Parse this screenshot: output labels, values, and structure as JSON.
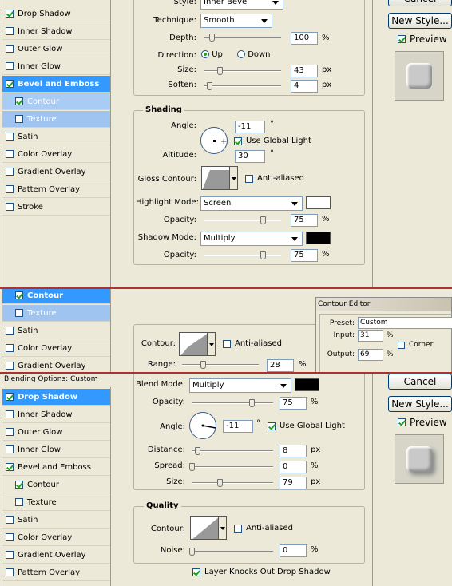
{
  "panel1": {
    "styles": [
      {
        "label": "Drop Shadow",
        "checked": true
      },
      {
        "label": "Inner Shadow",
        "checked": false
      },
      {
        "label": "Outer Glow",
        "checked": false
      },
      {
        "label": "Inner Glow",
        "checked": false
      },
      {
        "label": "Bevel and Emboss",
        "checked": true
      },
      {
        "label": "Contour",
        "checked": true
      },
      {
        "label": "Texture",
        "checked": false
      },
      {
        "label": "Satin",
        "checked": false
      },
      {
        "label": "Color Overlay",
        "checked": false
      },
      {
        "label": "Gradient Overlay",
        "checked": false
      },
      {
        "label": "Pattern Overlay",
        "checked": false
      },
      {
        "label": "Stroke",
        "checked": false
      }
    ],
    "style_label": "Style:",
    "style_value": "Inner Bevel",
    "technique_label": "Technique:",
    "technique_value": "Smooth",
    "depth_label": "Depth:",
    "depth_value": "100",
    "depth_pct": 100,
    "direction_label": "Direction:",
    "up_label": "Up",
    "down_label": "Down",
    "size_label": "Size:",
    "size_value": "43",
    "size_pct": 17,
    "soften_label": "Soften:",
    "soften_value": "4",
    "soften_pct": 4,
    "shading_title": "Shading",
    "angle_label": "Angle:",
    "angle_value": "-11",
    "degree": "°",
    "global_light": "Use Global Light",
    "altitude_label": "Altitude:",
    "altitude_value": "30",
    "gloss_label": "Gloss Contour:",
    "anti_aliased": "Anti-aliased",
    "highlight_label": "Highlight Mode:",
    "highlight_value": "Screen",
    "highlight_color": "#ffffff",
    "hl_opacity_label": "Opacity:",
    "hl_opacity_value": "75",
    "shadow_label": "Shadow Mode:",
    "shadow_value": "Multiply",
    "shadow_color": "#000000",
    "sh_opacity_label": "Opacity:",
    "sh_opacity_value": "75",
    "pct": "%",
    "px": "px",
    "cancel": "Cancel",
    "new_style": "New Style...",
    "preview": "Preview"
  },
  "panel2": {
    "styles": [
      {
        "label": "Contour",
        "checked": true
      },
      {
        "label": "Texture",
        "checked": false
      },
      {
        "label": "Satin",
        "checked": false
      },
      {
        "label": "Color Overlay",
        "checked": false
      },
      {
        "label": "Gradient Overlay",
        "checked": false
      }
    ],
    "contour_label": "Contour:",
    "anti_aliased": "Anti-aliased",
    "range_label": "Range:",
    "range_value": "28",
    "range_pct": 28,
    "editor_title": "Contour Editor",
    "preset_label": "Preset:",
    "preset_value": "Custom",
    "input_label": "Input:",
    "input_value": "31",
    "corner_label": "Corner",
    "output_label": "Output:",
    "output_value": "69"
  },
  "panel3": {
    "header": "Blending Options: Custom",
    "styles": [
      {
        "label": "Drop Shadow",
        "checked": true
      },
      {
        "label": "Inner Shadow",
        "checked": false
      },
      {
        "label": "Outer Glow",
        "checked": false
      },
      {
        "label": "Inner Glow",
        "checked": false
      },
      {
        "label": "Bevel and Emboss",
        "checked": true
      },
      {
        "label": "Contour",
        "checked": true
      },
      {
        "label": "Texture",
        "checked": false
      },
      {
        "label": "Satin",
        "checked": false
      },
      {
        "label": "Color Overlay",
        "checked": false
      },
      {
        "label": "Gradient Overlay",
        "checked": false
      },
      {
        "label": "Pattern Overlay",
        "checked": false
      }
    ],
    "blend_label": "Blend Mode:",
    "blend_value": "Multiply",
    "blend_color": "#000000",
    "opacity_label": "Opacity:",
    "opacity_value": "75",
    "opacity_pct": 75,
    "angle_label": "Angle:",
    "angle_value": "-11",
    "global_light": "Use Global Light",
    "distance_label": "Distance:",
    "distance_value": "8",
    "distance_pct": 5,
    "spread_label": "Spread:",
    "spread_value": "0",
    "spread_pct": 0,
    "size_label": "Size:",
    "size_value": "79",
    "size_pct": 32,
    "quality_title": "Quality",
    "contour_label": "Contour:",
    "anti_aliased": "Anti-aliased",
    "noise_label": "Noise:",
    "noise_value": "0",
    "noise_pct": 0,
    "knockout": "Layer Knocks Out Drop Shadow",
    "cancel": "Cancel",
    "new_style": "New Style...",
    "preview": "Preview"
  }
}
